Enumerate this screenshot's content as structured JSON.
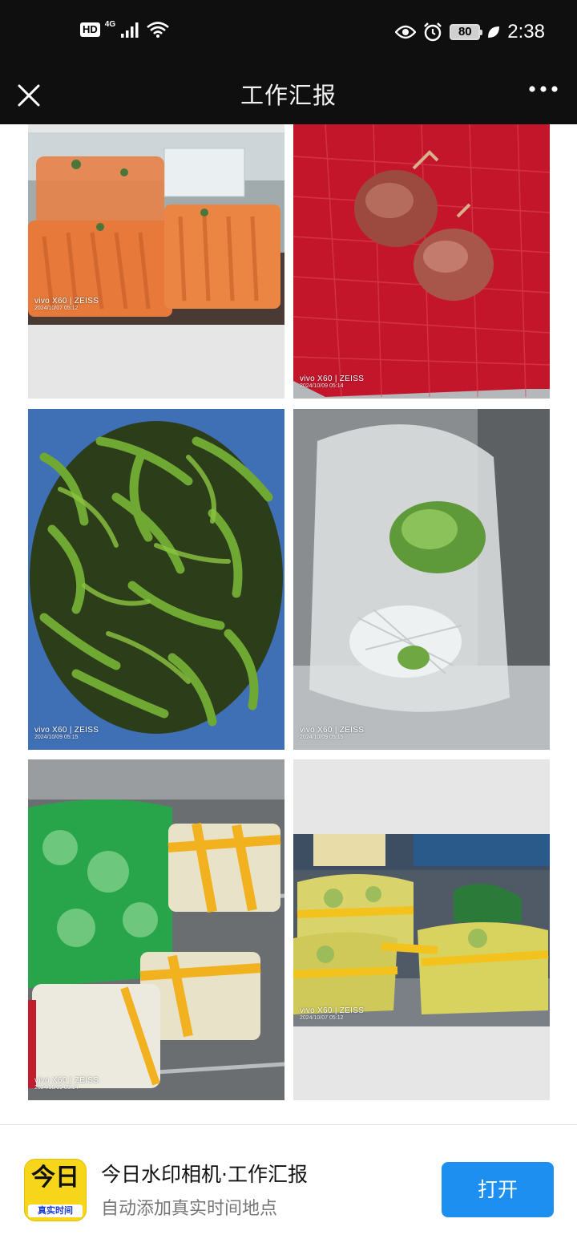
{
  "status_bar": {
    "hd": "HD",
    "network": "4G",
    "battery": "80",
    "time": "2:38",
    "icons": [
      "signal-icon",
      "wifi-icon",
      "eye-icon",
      "alarm-icon",
      "battery-icon",
      "leaf-icon"
    ]
  },
  "title_bar": {
    "title": "工作汇报",
    "left_icon": "close-icon",
    "right_icon": "more-icon"
  },
  "photos": [
    {
      "subject": "carrots",
      "watermark": "vivo X60 | ZEISS",
      "date": "2024/10/07 05:12"
    },
    {
      "subject": "onions",
      "watermark": "vivo X60 | ZEISS",
      "date": "2024/10/09 05:14"
    },
    {
      "subject": "green peppers",
      "watermark": "vivo X60 | ZEISS",
      "date": "2024/10/09 05:15"
    },
    {
      "subject": "lettuce",
      "watermark": "vivo X60 | ZEISS",
      "date": "2024/10/09 05:15"
    },
    {
      "subject": "cabbage",
      "watermark": "vivo X60 | ZEISS",
      "date": "2024/10/09 05:14"
    },
    {
      "subject": "bok choy",
      "watermark": "vivo X60 | ZEISS",
      "date": "2024/10/07 05:12"
    }
  ],
  "banner": {
    "app_name": "今日水印相机·工作汇报",
    "subtitle": "自动添加真实时间地点",
    "open_label": "打开",
    "icon_top": "今日",
    "icon_bottom": "真实时间"
  },
  "colors": {
    "header_bg": "#0f0f0f",
    "open_button": "#1d8ff0",
    "app_icon_yellow": "#f7d51a"
  }
}
